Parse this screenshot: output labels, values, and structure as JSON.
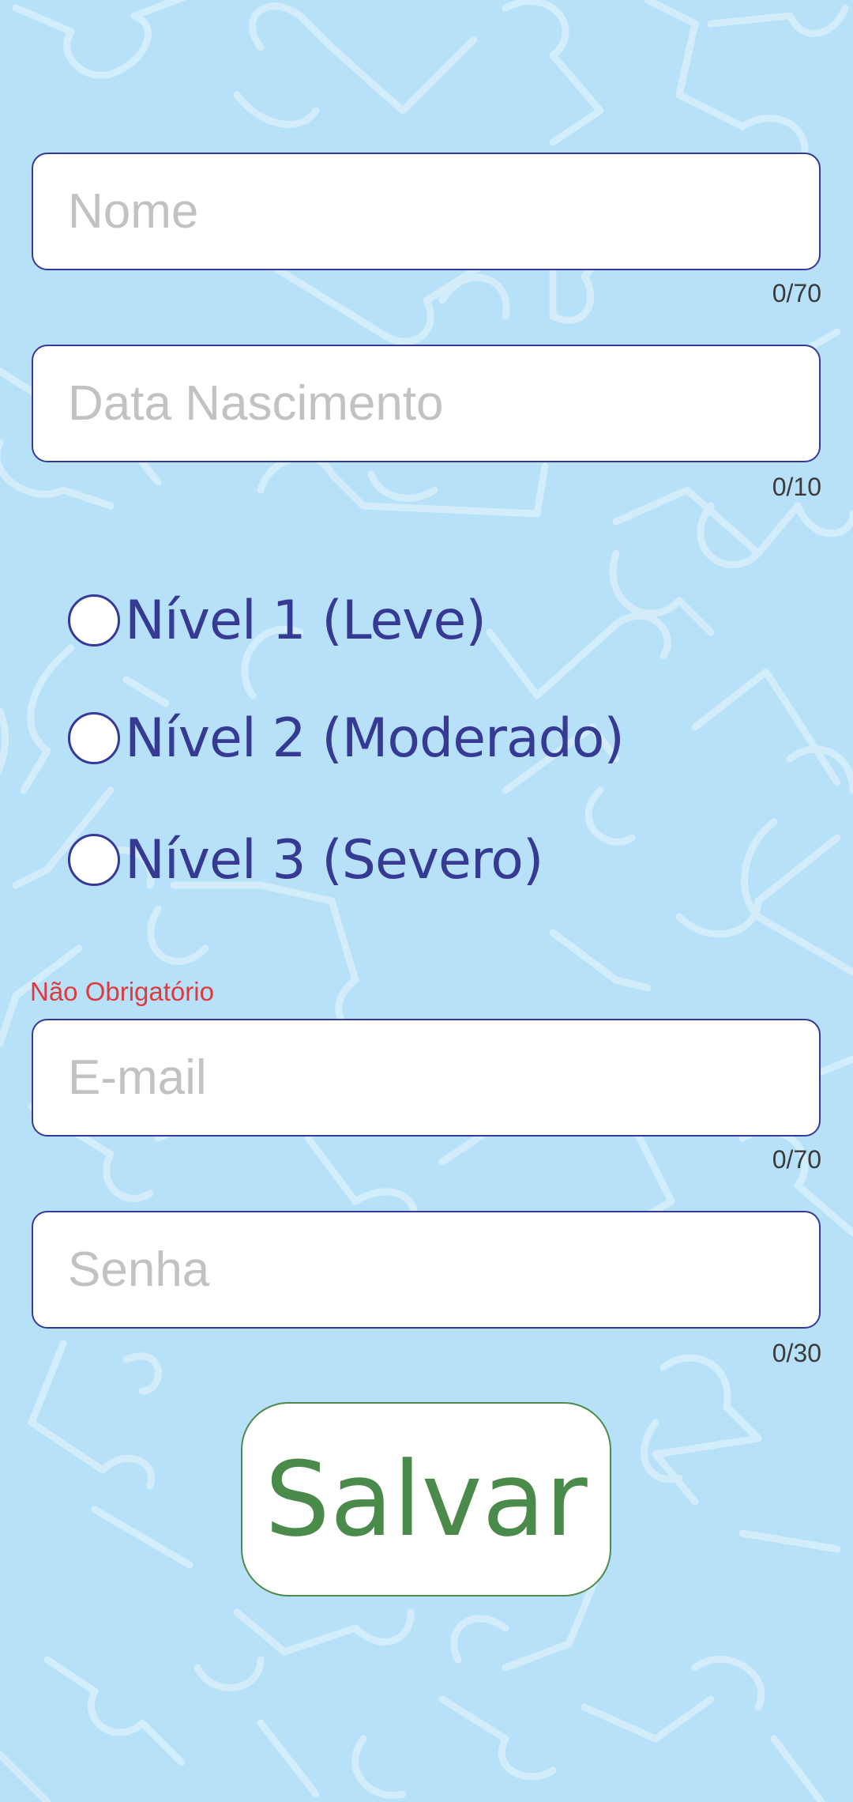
{
  "form": {
    "name": {
      "value": "",
      "placeholder": "Nome",
      "counter": "0/70"
    },
    "birthdate": {
      "value": "",
      "placeholder": "Data Nascimento",
      "counter": "0/10"
    },
    "levels": [
      {
        "label": "Nível 1 (Leve)",
        "selected": false
      },
      {
        "label": "Nível 2 (Moderado)",
        "selected": false
      },
      {
        "label": "Nível 3 (Severo)",
        "selected": false
      }
    ],
    "optional_note": "Não Obrigatório",
    "email": {
      "value": "",
      "placeholder": "E-mail",
      "counter": "0/70"
    },
    "password": {
      "value": "",
      "placeholder": "Senha",
      "counter": "0/30"
    },
    "save_label": "Salvar"
  },
  "colors": {
    "background": "#b6e1f8",
    "field_border": "#36389a",
    "radio_text": "#363a93",
    "optional_note": "#e03a3e",
    "save_text": "#4a8a4a"
  }
}
